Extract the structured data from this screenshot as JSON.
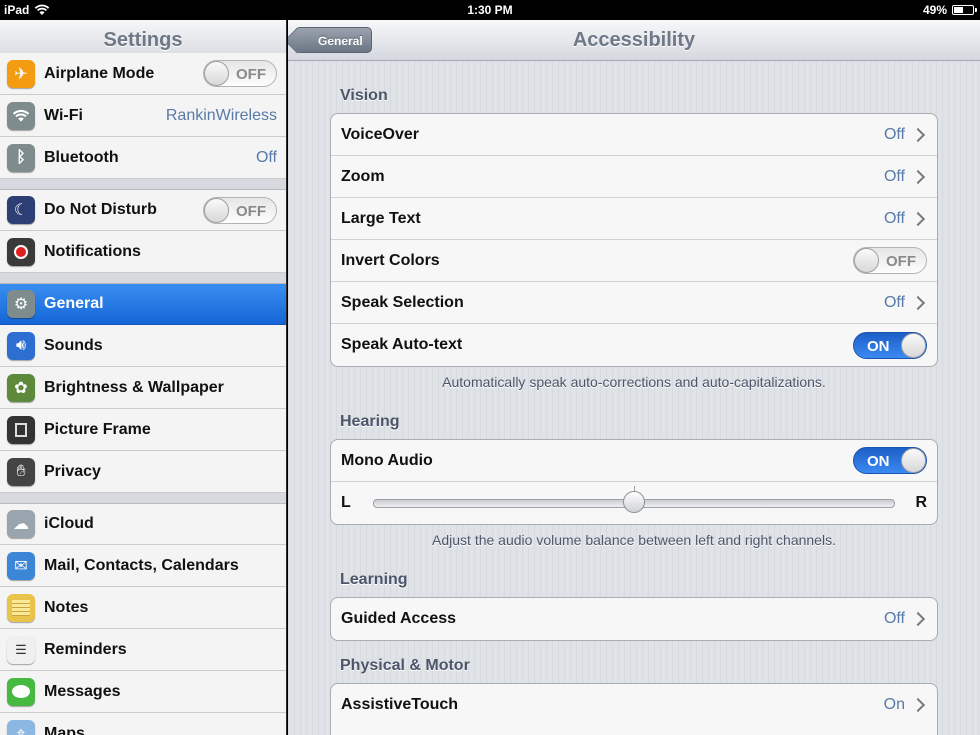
{
  "status_bar": {
    "carrier": "iPad",
    "time": "1:30 PM",
    "battery_text": "49%",
    "battery_level": 0.49
  },
  "sidebar": {
    "title": "Settings",
    "items": [
      {
        "label": "Airplane Mode",
        "icon": "airplane-icon",
        "color": "#f39c12",
        "switch": "OFF"
      },
      {
        "label": "Wi-Fi",
        "icon": "wifi-icon",
        "color": "#7f8c8d",
        "value": "RankinWireless"
      },
      {
        "label": "Bluetooth",
        "icon": "bluetooth-icon",
        "color": "#7f8c8d",
        "value": "Off"
      },
      {
        "label": "Do Not Disturb",
        "icon": "moon-icon",
        "color": "#2c3e73",
        "switch": "OFF"
      },
      {
        "label": "Notifications",
        "icon": "notifications-icon",
        "color": "#3a3a3a"
      },
      {
        "label": "General",
        "icon": "gear-icon",
        "color": "#7f8c8d",
        "selected": true
      },
      {
        "label": "Sounds",
        "icon": "speaker-icon",
        "color": "#2d6fd1"
      },
      {
        "label": "Brightness & Wallpaper",
        "icon": "flower-icon",
        "color": "#5c8a3a"
      },
      {
        "label": "Picture Frame",
        "icon": "picture-frame-icon",
        "color": "#333333"
      },
      {
        "label": "Privacy",
        "icon": "hand-icon",
        "color": "#444444"
      },
      {
        "label": "iCloud",
        "icon": "cloud-icon",
        "color": "#9aa4ae"
      },
      {
        "label": "Mail, Contacts, Calendars",
        "icon": "mail-icon",
        "color": "#3b86d6"
      },
      {
        "label": "Notes",
        "icon": "notes-icon",
        "color": "#e8c44a"
      },
      {
        "label": "Reminders",
        "icon": "reminders-icon",
        "color": "#f0f0f0"
      },
      {
        "label": "Messages",
        "icon": "messages-icon",
        "color": "#46b940"
      },
      {
        "label": "Maps",
        "icon": "maps-icon",
        "color": "#8bb7e0"
      }
    ]
  },
  "detail": {
    "back_label": "General",
    "title": "Accessibility",
    "vision": {
      "header": "Vision",
      "rows": [
        {
          "label": "VoiceOver",
          "value": "Off"
        },
        {
          "label": "Zoom",
          "value": "Off"
        },
        {
          "label": "Large Text",
          "value": "Off"
        },
        {
          "label": "Invert Colors",
          "switch": "OFF"
        },
        {
          "label": "Speak Selection",
          "value": "Off"
        },
        {
          "label": "Speak Auto-text",
          "switch": "ON"
        }
      ],
      "footer": "Automatically speak auto-corrections and auto-capitalizations."
    },
    "hearing": {
      "header": "Hearing",
      "mono_audio_label": "Mono Audio",
      "mono_audio_switch": "ON",
      "balance_left": "L",
      "balance_right": "R",
      "balance_value": 0.5,
      "footer": "Adjust the audio volume balance between left and right channels."
    },
    "learning": {
      "header": "Learning",
      "rows": [
        {
          "label": "Guided Access",
          "value": "Off"
        }
      ]
    },
    "physical": {
      "header": "Physical & Motor",
      "rows": [
        {
          "label": "AssistiveTouch",
          "value": "On"
        }
      ]
    }
  }
}
